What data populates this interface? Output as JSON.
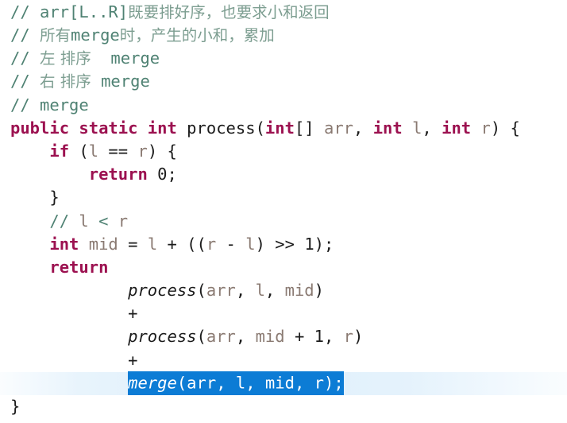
{
  "editor": {
    "language": "java",
    "colors": {
      "background": "#ffffff",
      "comment": "#4f8273",
      "comment_cjk": "#7d9e91",
      "keyword": "#9c1150",
      "identifier": "#1b1b1b",
      "variable": "#8a7a72",
      "selection_background": "#0c7cd5",
      "selection_foreground": "#ffffff",
      "current_line_background": "#def0fc"
    },
    "lines": [
      {
        "id": "line-1",
        "indent": "",
        "kind": "comment",
        "tokens": [
          {
            "cls": "cmt",
            "text": "// arr[L..R]"
          },
          {
            "cls": "cmt-cjk",
            "text": "既要排好序，也要求小和返回"
          }
        ],
        "plain_text": "// arr[L..R]既要排好序，也要求小和返回"
      },
      {
        "id": "line-2",
        "indent": "",
        "kind": "comment",
        "tokens": [
          {
            "cls": "cmt",
            "text": "// "
          },
          {
            "cls": "cmt-cjk",
            "text": "所有"
          },
          {
            "cls": "cmt",
            "text": "merge"
          },
          {
            "cls": "cmt-cjk",
            "text": "时，产生的小和，累加"
          }
        ],
        "plain_text": "// 所有merge时，产生的小和，累加"
      },
      {
        "id": "line-3",
        "indent": "",
        "kind": "comment",
        "tokens": [
          {
            "cls": "cmt",
            "text": "// "
          },
          {
            "cls": "cmt-cjk",
            "text": "左 排序"
          },
          {
            "cls": "cmt",
            "text": "  merge"
          }
        ],
        "plain_text": "// 左 排序  merge"
      },
      {
        "id": "line-4",
        "indent": "",
        "kind": "comment",
        "tokens": [
          {
            "cls": "cmt",
            "text": "// "
          },
          {
            "cls": "cmt-cjk",
            "text": "右 排序"
          },
          {
            "cls": "cmt",
            "text": " merge"
          }
        ],
        "plain_text": "// 右 排序 merge"
      },
      {
        "id": "line-5",
        "indent": "",
        "kind": "comment",
        "tokens": [
          {
            "cls": "cmt",
            "text": "// merge"
          }
        ],
        "plain_text": "// merge"
      },
      {
        "id": "line-6",
        "indent": "",
        "kind": "code",
        "tokens": [
          {
            "cls": "kw",
            "text": "public static int"
          },
          {
            "cls": "plain",
            "text": " process("
          },
          {
            "cls": "kw",
            "text": "int"
          },
          {
            "cls": "plain",
            "text": "[] "
          },
          {
            "cls": "var",
            "text": "arr"
          },
          {
            "cls": "plain",
            "text": ", "
          },
          {
            "cls": "kw",
            "text": "int"
          },
          {
            "cls": "plain",
            "text": " "
          },
          {
            "cls": "var",
            "text": "l"
          },
          {
            "cls": "plain",
            "text": ", "
          },
          {
            "cls": "kw",
            "text": "int"
          },
          {
            "cls": "plain",
            "text": " "
          },
          {
            "cls": "var",
            "text": "r"
          },
          {
            "cls": "plain",
            "text": ") {"
          }
        ],
        "plain_text": "public static int process(int[] arr, int l, int r) {"
      },
      {
        "id": "line-7",
        "indent": "    ",
        "kind": "code",
        "tokens": [
          {
            "cls": "kw",
            "text": "if"
          },
          {
            "cls": "plain",
            "text": " ("
          },
          {
            "cls": "var",
            "text": "l"
          },
          {
            "cls": "plain",
            "text": " == "
          },
          {
            "cls": "var",
            "text": "r"
          },
          {
            "cls": "plain",
            "text": ") {"
          }
        ],
        "plain_text": "    if (l == r) {"
      },
      {
        "id": "line-8",
        "indent": "        ",
        "kind": "code",
        "tokens": [
          {
            "cls": "kw",
            "text": "return"
          },
          {
            "cls": "plain",
            "text": " "
          },
          {
            "cls": "num",
            "text": "0"
          },
          {
            "cls": "plain",
            "text": ";"
          }
        ],
        "plain_text": "        return 0;"
      },
      {
        "id": "line-9",
        "indent": "    ",
        "kind": "code",
        "tokens": [
          {
            "cls": "plain",
            "text": "}"
          }
        ],
        "plain_text": "    }"
      },
      {
        "id": "line-10",
        "indent": "    ",
        "kind": "comment",
        "tokens": [
          {
            "cls": "cmt",
            "text": "// "
          },
          {
            "cls": "var",
            "text": "l"
          },
          {
            "cls": "cmt",
            "text": " < "
          },
          {
            "cls": "var",
            "text": "r"
          }
        ],
        "plain_text": "    // l < r"
      },
      {
        "id": "line-11",
        "indent": "    ",
        "kind": "code",
        "tokens": [
          {
            "cls": "kw",
            "text": "int"
          },
          {
            "cls": "plain",
            "text": " "
          },
          {
            "cls": "var",
            "text": "mid"
          },
          {
            "cls": "plain",
            "text": " = "
          },
          {
            "cls": "var",
            "text": "l"
          },
          {
            "cls": "plain",
            "text": " + (("
          },
          {
            "cls": "var",
            "text": "r"
          },
          {
            "cls": "plain",
            "text": " - "
          },
          {
            "cls": "var",
            "text": "l"
          },
          {
            "cls": "plain",
            "text": ") >> "
          },
          {
            "cls": "num",
            "text": "1"
          },
          {
            "cls": "plain",
            "text": ");"
          }
        ],
        "plain_text": "    int mid = l + ((r - l) >> 1);"
      },
      {
        "id": "line-12",
        "indent": "    ",
        "kind": "code",
        "tokens": [
          {
            "cls": "kw",
            "text": "return"
          }
        ],
        "plain_text": "    return"
      },
      {
        "id": "line-13",
        "indent": "            ",
        "kind": "code",
        "tokens": [
          {
            "cls": "mcall",
            "text": "process"
          },
          {
            "cls": "plain",
            "text": "("
          },
          {
            "cls": "var",
            "text": "arr"
          },
          {
            "cls": "plain",
            "text": ", "
          },
          {
            "cls": "var",
            "text": "l"
          },
          {
            "cls": "plain",
            "text": ", "
          },
          {
            "cls": "var",
            "text": "mid"
          },
          {
            "cls": "plain",
            "text": ")"
          }
        ],
        "plain_text": "            process(arr, l, mid)"
      },
      {
        "id": "line-14",
        "indent": "            ",
        "kind": "code",
        "tokens": [
          {
            "cls": "plain",
            "text": "+"
          }
        ],
        "plain_text": "            +"
      },
      {
        "id": "line-15",
        "indent": "            ",
        "kind": "code",
        "tokens": [
          {
            "cls": "mcall",
            "text": "process"
          },
          {
            "cls": "plain",
            "text": "("
          },
          {
            "cls": "var",
            "text": "arr"
          },
          {
            "cls": "plain",
            "text": ", "
          },
          {
            "cls": "var",
            "text": "mid"
          },
          {
            "cls": "plain",
            "text": " + "
          },
          {
            "cls": "num",
            "text": "1"
          },
          {
            "cls": "plain",
            "text": ", "
          },
          {
            "cls": "var",
            "text": "r"
          },
          {
            "cls": "plain",
            "text": ")"
          }
        ],
        "plain_text": "            process(arr, mid + 1, r)"
      },
      {
        "id": "line-16",
        "indent": "            ",
        "kind": "code",
        "tokens": [
          {
            "cls": "plain",
            "text": "+"
          }
        ],
        "plain_text": "            +"
      },
      {
        "id": "line-17",
        "indent": "            ",
        "kind": "code",
        "current": true,
        "selected": true,
        "tokens": [
          {
            "cls": "mcall",
            "text": "merge"
          },
          {
            "cls": "plain",
            "text": "("
          },
          {
            "cls": "var",
            "text": "arr"
          },
          {
            "cls": "plain",
            "text": ", "
          },
          {
            "cls": "var",
            "text": "l"
          },
          {
            "cls": "plain",
            "text": ", "
          },
          {
            "cls": "var",
            "text": "mid"
          },
          {
            "cls": "plain",
            "text": ", "
          },
          {
            "cls": "var",
            "text": "r"
          },
          {
            "cls": "plain",
            "text": ");"
          }
        ],
        "plain_text": "            merge(arr, l, mid, r);"
      },
      {
        "id": "line-18",
        "indent": "",
        "kind": "code",
        "tokens": [
          {
            "cls": "plain",
            "text": "}"
          }
        ],
        "plain_text": "}"
      }
    ]
  }
}
